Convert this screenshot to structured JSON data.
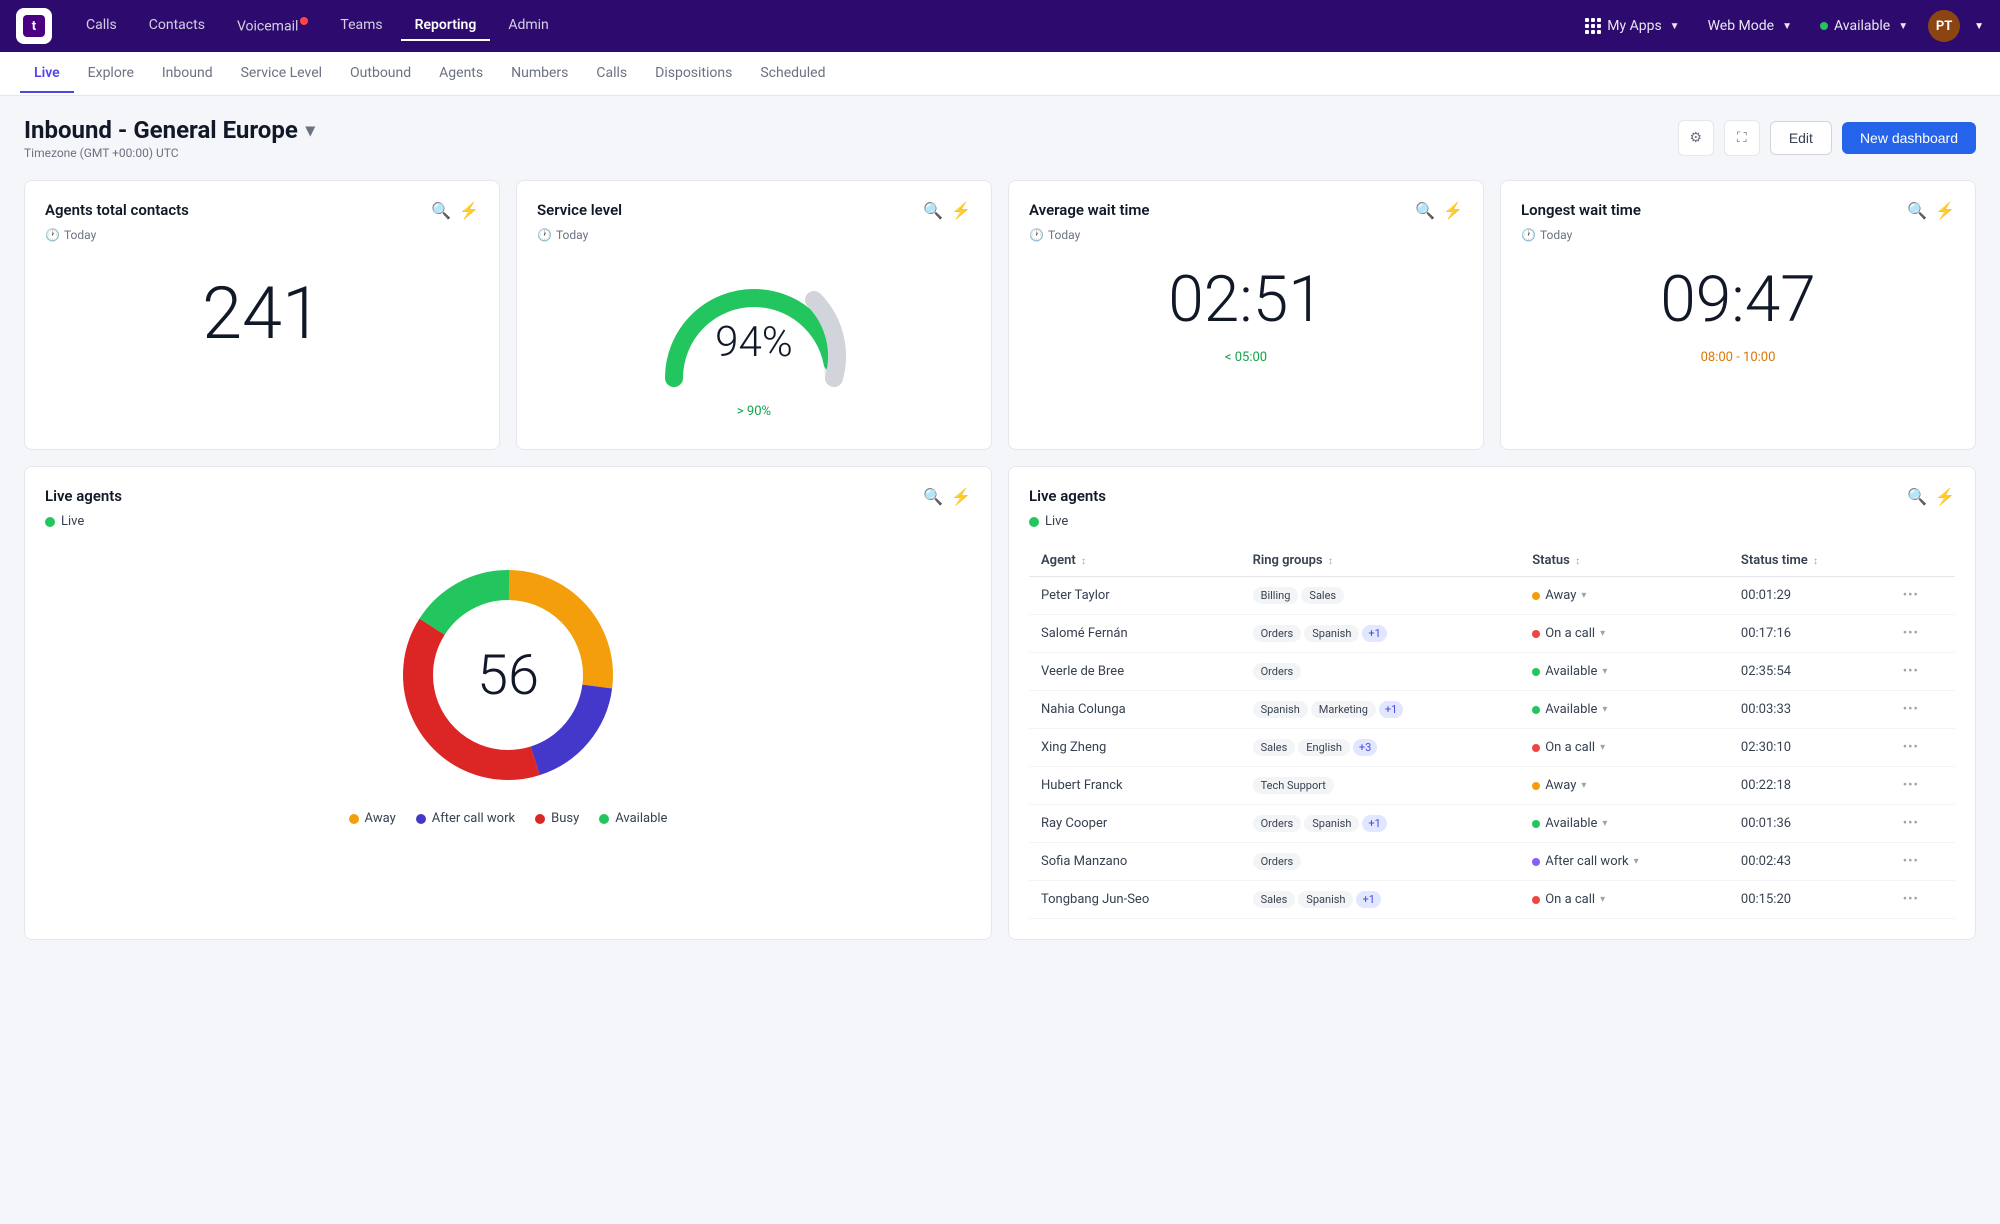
{
  "app": {
    "logo_text": "t",
    "nav_items": [
      {
        "label": "Calls",
        "active": false
      },
      {
        "label": "Contacts",
        "active": false
      },
      {
        "label": "Voicemail",
        "active": false,
        "badge": true
      },
      {
        "label": "Teams",
        "active": false
      },
      {
        "label": "Reporting",
        "active": true
      },
      {
        "label": "Admin",
        "active": false
      }
    ],
    "nav_right": {
      "my_apps_label": "My Apps",
      "web_mode_label": "Web Mode",
      "status_label": "Available"
    }
  },
  "sub_nav": {
    "items": [
      {
        "label": "Live",
        "active": true
      },
      {
        "label": "Explore",
        "active": false
      },
      {
        "label": "Inbound",
        "active": false
      },
      {
        "label": "Service Level",
        "active": false
      },
      {
        "label": "Outbound",
        "active": false
      },
      {
        "label": "Agents",
        "active": false
      },
      {
        "label": "Numbers",
        "active": false
      },
      {
        "label": "Calls",
        "active": false
      },
      {
        "label": "Dispositions",
        "active": false
      },
      {
        "label": "Scheduled",
        "active": false
      }
    ]
  },
  "dashboard": {
    "title": "Inbound - General Europe",
    "subtitle": "Timezone (GMT +00:00) UTC",
    "edit_label": "Edit",
    "new_dashboard_label": "New dashboard"
  },
  "widgets": {
    "agents_total": {
      "title": "Agents total contacts",
      "period": "Today",
      "value": "241"
    },
    "service_level": {
      "title": "Service level",
      "period": "Today",
      "value": "94%",
      "raw": 94,
      "note": "> 90%"
    },
    "avg_wait": {
      "title": "Average wait time",
      "period": "Today",
      "value": "02:51",
      "note": "< 05:00"
    },
    "longest_wait": {
      "title": "Longest wait time",
      "period": "Today",
      "value": "09:47",
      "note": "08:00 - 10:00"
    }
  },
  "live_agents_donut": {
    "title": "Live agents",
    "live_label": "Live",
    "total": "56",
    "segments": [
      {
        "label": "Away",
        "color": "#f59e0b",
        "value": 15,
        "percent": 0.15
      },
      {
        "label": "After call work",
        "color": "#4338ca",
        "value": 10,
        "percent": 0.1
      },
      {
        "label": "Busy",
        "color": "#dc2626",
        "value": 22,
        "percent": 0.22
      },
      {
        "label": "Available",
        "color": "#22c55e",
        "value": 9,
        "percent": 0.09
      }
    ]
  },
  "live_agents_table": {
    "title": "Live agents",
    "live_label": "Live",
    "columns": [
      "Agent",
      "Ring groups",
      "Status",
      "Status time"
    ],
    "rows": [
      {
        "agent": "Peter Taylor",
        "ring_groups": [
          "Billing",
          "Sales"
        ],
        "ring_groups_extra": 0,
        "status": "Away",
        "status_color": "yellow",
        "status_time": "00:01:29"
      },
      {
        "agent": "Salomé Fernán",
        "ring_groups": [
          "Orders",
          "Spanish"
        ],
        "ring_groups_extra": 1,
        "status": "On a call",
        "status_color": "red",
        "status_time": "00:17:16"
      },
      {
        "agent": "Veerle de Bree",
        "ring_groups": [
          "Orders"
        ],
        "ring_groups_extra": 0,
        "status": "Available",
        "status_color": "green",
        "status_time": "02:35:54"
      },
      {
        "agent": "Nahia Colunga",
        "ring_groups": [
          "Spanish",
          "Marketing"
        ],
        "ring_groups_extra": 1,
        "status": "Available",
        "status_color": "green",
        "status_time": "00:03:33"
      },
      {
        "agent": "Xing Zheng",
        "ring_groups": [
          "Sales",
          "English"
        ],
        "ring_groups_extra": 3,
        "status": "On a call",
        "status_color": "red",
        "status_time": "02:30:10"
      },
      {
        "agent": "Hubert Franck",
        "ring_groups": [
          "Tech Support"
        ],
        "ring_groups_extra": 0,
        "status": "Away",
        "status_color": "yellow",
        "status_time": "00:22:18"
      },
      {
        "agent": "Ray Cooper",
        "ring_groups": [
          "Orders",
          "Spanish"
        ],
        "ring_groups_extra": 1,
        "status": "Available",
        "status_color": "green",
        "status_time": "00:01:36"
      },
      {
        "agent": "Sofia Manzano",
        "ring_groups": [
          "Orders"
        ],
        "ring_groups_extra": 0,
        "status": "After call work",
        "status_color": "purple",
        "status_time": "00:02:43"
      },
      {
        "agent": "Tongbang Jun-Seo",
        "ring_groups": [
          "Sales",
          "Spanish"
        ],
        "ring_groups_extra": 1,
        "status": "On a call",
        "status_color": "red",
        "status_time": "00:15:20"
      }
    ]
  }
}
